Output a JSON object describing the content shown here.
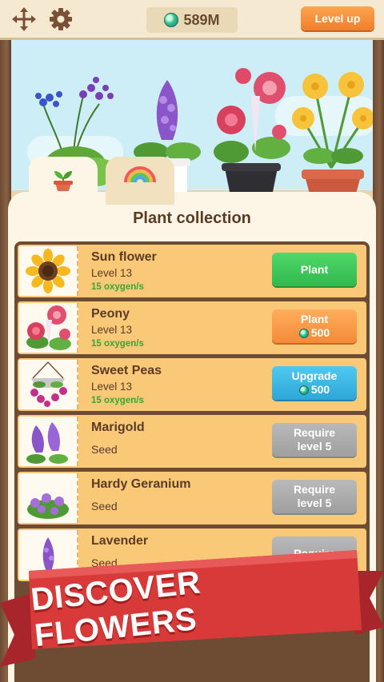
{
  "topbar": {
    "currency_value": "589M",
    "level_up_label": "Level up",
    "icons": [
      "move-arrows-icon",
      "gear-icon",
      "gem-icon"
    ]
  },
  "panel": {
    "title": "Plant collection",
    "tabs": [
      {
        "name": "plants",
        "icon": "sprout-pot-icon",
        "active": true
      },
      {
        "name": "decorations",
        "icon": "rainbow-icon",
        "active": false
      }
    ]
  },
  "plants": [
    {
      "name": "Sun flower",
      "level": "Level 13",
      "oxygen": "15 oxygen/s",
      "button": {
        "line1": "Plant",
        "cost": "",
        "style": "green"
      }
    },
    {
      "name": "Peony",
      "level": "Level 13",
      "oxygen": "15 oxygen/s",
      "button": {
        "line1": "Plant",
        "cost": "500",
        "style": "orange"
      }
    },
    {
      "name": "Sweet Peas",
      "level": "Level 13",
      "oxygen": "15 oxygen/s",
      "button": {
        "line1": "Upgrade",
        "cost": "500",
        "style": "blue"
      }
    },
    {
      "name": "Marigold",
      "status": "Seed",
      "button": {
        "line1": "Require",
        "line2": "level 5",
        "style": "gray"
      }
    },
    {
      "name": "Hardy Geranium",
      "status": "Seed",
      "button": {
        "line1": "Require",
        "line2": "level 5",
        "style": "gray"
      }
    },
    {
      "name": "Lavender",
      "status": "Seed",
      "button": {
        "line1": "Require",
        "line2": "",
        "style": "gray"
      }
    }
  ],
  "banner": {
    "text": "DISCOVER FLOWERS"
  },
  "colors": {
    "accent_orange": "#f48a38",
    "plant_green": "#32b84d",
    "upgrade_blue": "#2ea6d8",
    "locked_gray": "#9f9f9f",
    "row_background": "#f9c978",
    "banner_red": "#d83a3a"
  }
}
